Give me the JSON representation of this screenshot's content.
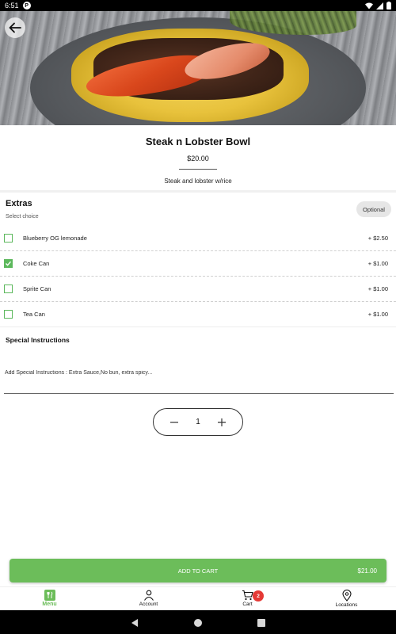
{
  "status_bar": {
    "time": "6:51",
    "app_badge": "P"
  },
  "product": {
    "title": "Steak n Lobster Bowl",
    "price": "$20.00",
    "description": "Steak and lobster w/rice"
  },
  "extras": {
    "title": "Extras",
    "subtitle": "Select choice",
    "badge": "Optional",
    "items": [
      {
        "label": "Blueberry OG lemonade",
        "price": "+ $2.50",
        "checked": false
      },
      {
        "label": "Coke Can",
        "price": "+ $1.00",
        "checked": true
      },
      {
        "label": "Sprite Can",
        "price": "+ $1.00",
        "checked": false
      },
      {
        "label": "Tea Can",
        "price": "+ $1.00",
        "checked": false
      }
    ]
  },
  "special": {
    "title": "Special Instructions",
    "placeholder": "Add Special Instructions : Extra Sauce,No bun, extra spicy..."
  },
  "quantity": {
    "value": "1"
  },
  "add_to_cart": {
    "label": "ADD TO CART",
    "total": "$21.00"
  },
  "bottom_nav": {
    "items": [
      {
        "label": "Menu",
        "icon": "fork-knife-icon",
        "active": true
      },
      {
        "label": "Account",
        "icon": "person-icon",
        "active": false
      },
      {
        "label": "Cart",
        "icon": "cart-icon",
        "active": false
      },
      {
        "label": "Locations",
        "icon": "location-pin-icon",
        "active": false
      }
    ],
    "cart_count": "2"
  },
  "colors": {
    "accent": "#6cbd5a",
    "badge_red": "#e53935",
    "checkbox": "#5cb85c"
  }
}
